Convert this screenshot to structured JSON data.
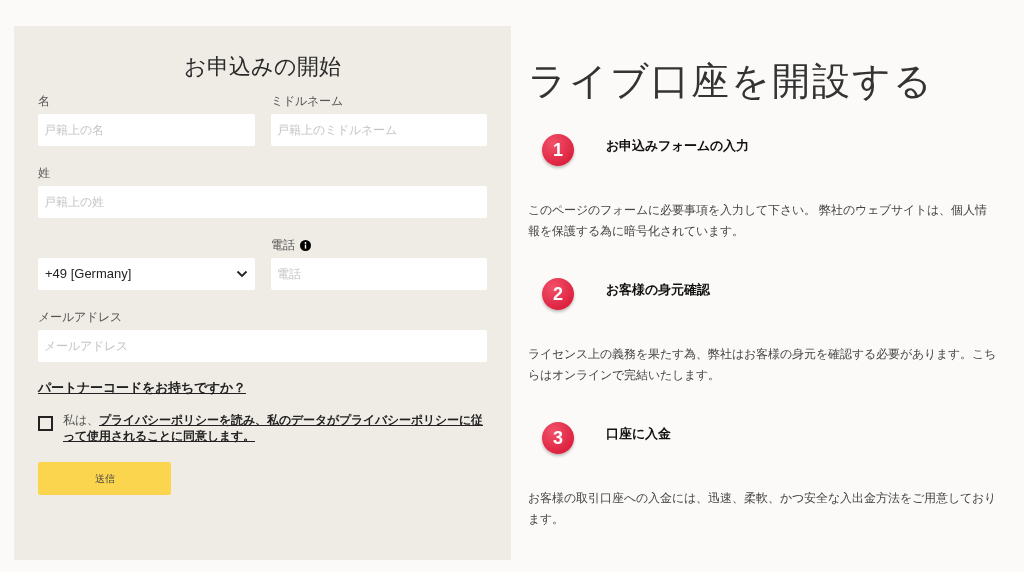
{
  "form": {
    "title": "お申込みの開始",
    "rows": [
      [
        {
          "label": "名",
          "placeholder": "戸籍上の名",
          "kind": "text"
        },
        {
          "label": "ミドルネーム",
          "placeholder": "戸籍上のミドルネーム",
          "kind": "text"
        }
      ],
      [
        {
          "label": "姓",
          "placeholder": "戸籍上の姓",
          "kind": "text"
        }
      ],
      [
        {
          "value": "+49 [Germany]",
          "kind": "select"
        },
        {
          "label": "電話",
          "placeholder": "電話",
          "kind": "text",
          "info": true
        }
      ],
      [
        {
          "label": "メールアドレス",
          "placeholder": "メールアドレス",
          "kind": "text"
        }
      ]
    ],
    "partner_link": "パートナーコードをお持ちですか？",
    "consent": {
      "checked": false,
      "text": "私は、**プライバシーポリシーを読み、私のデータがプライバシーポリシーに従って使用されることに同意します。**"
    },
    "submit": "送信"
  },
  "info": {
    "title": "ライブ口座を開設する",
    "steps": [
      {
        "number": "1",
        "title": "お申込みフォームの入力",
        "text": "このページのフォームに必要事項を入力して下さい。 弊社のウェブサイトは、個人情報を保護する為に暗号化されています。"
      },
      {
        "number": "2",
        "title": "お客様の身元確認",
        "text": "ライセンス上の義務を果たす為、弊社はお客様の身元を確認する必要があります。こちらはオンラインで完結いたします。"
      },
      {
        "number": "3",
        "title": "口座に入金",
        "text": "お客様の取引口座への入金には、迅速、柔軟、かつ安全な入出金方法をご用意しております。"
      }
    ]
  }
}
